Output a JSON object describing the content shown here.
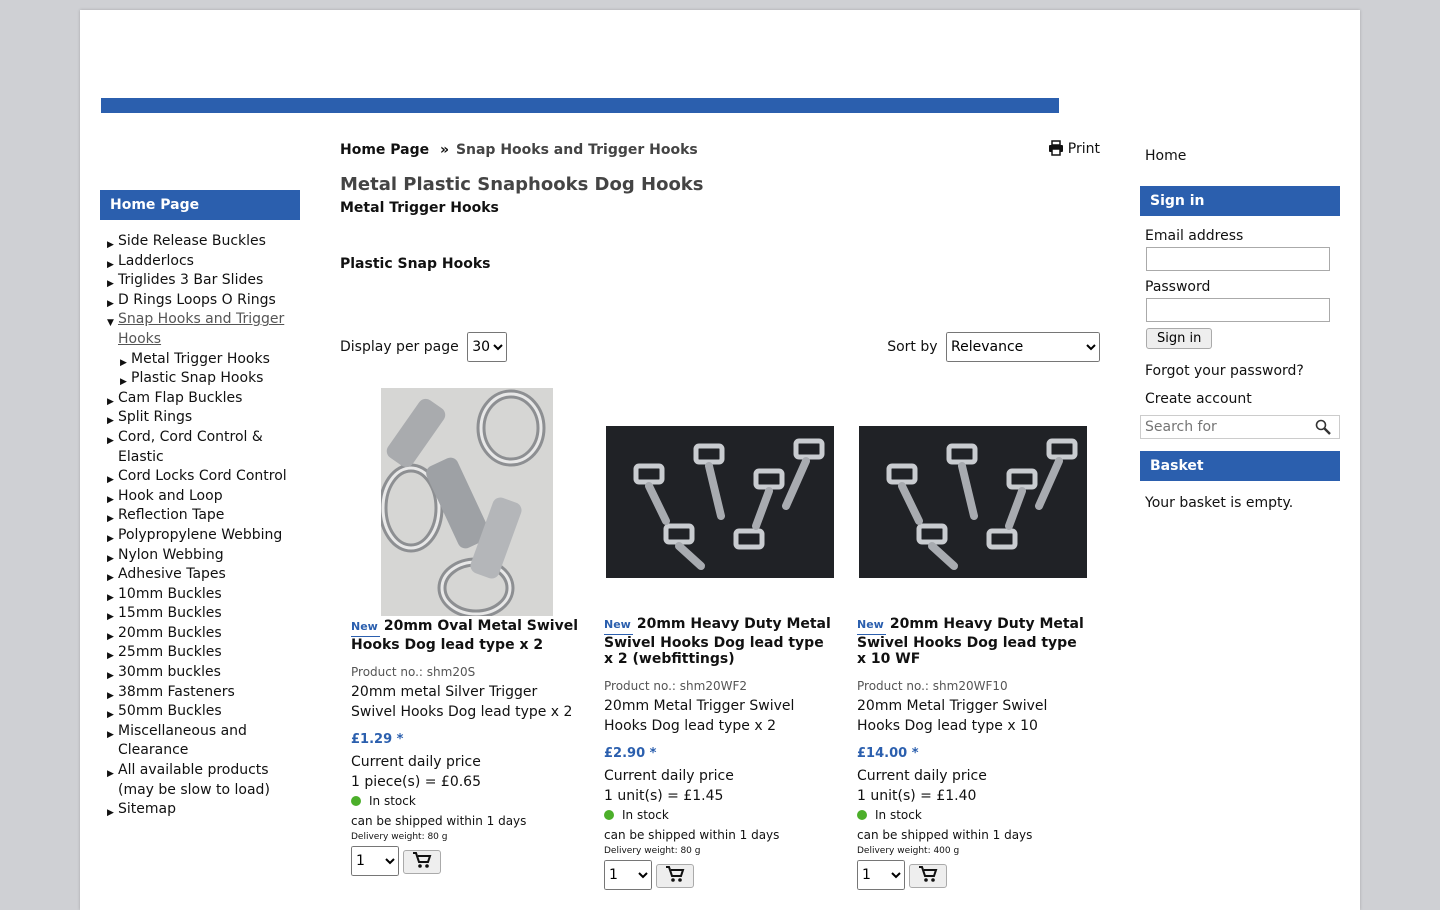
{
  "left_nav": {
    "heading": "Home Page",
    "items": [
      {
        "label": "Side Release Buckles"
      },
      {
        "label": "Ladderlocs"
      },
      {
        "label": "Triglides 3 Bar Slides"
      },
      {
        "label": "D Rings Loops O Rings"
      },
      {
        "label": "Snap Hooks and Trigger Hooks",
        "open": true
      },
      {
        "label": "Metal Trigger Hooks",
        "sub": true
      },
      {
        "label": "Plastic Snap Hooks",
        "sub": true
      },
      {
        "label": "Cam Flap Buckles"
      },
      {
        "label": "Split Rings"
      },
      {
        "label": "Cord, Cord Control & Elastic"
      },
      {
        "label": "Cord Locks Cord Control"
      },
      {
        "label": "Hook and Loop"
      },
      {
        "label": "Reflection Tape"
      },
      {
        "label": "Polypropylene Webbing"
      },
      {
        "label": "Nylon Webbing"
      },
      {
        "label": "Adhesive Tapes"
      },
      {
        "label": "10mm Buckles"
      },
      {
        "label": "15mm Buckles"
      },
      {
        "label": "20mm Buckles"
      },
      {
        "label": "25mm Buckles"
      },
      {
        "label": "30mm buckles"
      },
      {
        "label": "38mm Fasteners"
      },
      {
        "label": "50mm Buckles"
      },
      {
        "label": "Miscellaneous and Clearance"
      },
      {
        "label": "All available products (may be slow to load)"
      },
      {
        "label": "Sitemap"
      }
    ]
  },
  "breadcrumb": {
    "home": "Home Page",
    "separator": "»",
    "current": "Snap Hooks and Trigger Hooks"
  },
  "print_label": "Print",
  "page_title": "Metal Plastic Snaphooks Dog Hooks",
  "subcategories": [
    "Metal Trigger Hooks",
    "Plastic Snap Hooks"
  ],
  "controls": {
    "display_label": "Display per page",
    "display_value": "30",
    "sort_label": "Sort by",
    "sort_value": "Relevance"
  },
  "products": [
    {
      "badge": "New",
      "name": "20mm Oval Metal Swivel Hooks Dog lead type x 2",
      "product_no": "Product no.: shm20S",
      "description": "20mm metal Silver Trigger Swivel Hooks Dog lead type x 2",
      "price": "£1.29 *",
      "daily_label": "Current daily price",
      "unit_price": "1 piece(s) = £0.65",
      "stock": "In stock",
      "shipping": "can be shipped within 1 days",
      "weight": "Delivery weight: 80 g",
      "qty": "1"
    },
    {
      "badge": "New",
      "name": "20mm Heavy Duty Metal Swivel Hooks Dog lead type x 2 (webfittings)",
      "product_no": "Product no.: shm20WF2",
      "description": "20mm Metal Trigger Swivel Hooks Dog lead type x 2",
      "price": "£2.90 *",
      "daily_label": "Current daily price",
      "unit_price": "1 unit(s) = £1.45",
      "stock": "In stock",
      "shipping": "can be shipped within 1 days",
      "weight": "Delivery weight: 80 g",
      "qty": "1"
    },
    {
      "badge": "New",
      "name": "20mm Heavy Duty Metal Swivel Hooks Dog lead type x 10 WF",
      "product_no": "Product no.: shm20WF10",
      "description": "20mm Metal Trigger Swivel Hooks Dog lead type x 10",
      "price": "£14.00 *",
      "daily_label": "Current daily price",
      "unit_price": "1 unit(s) = £1.40",
      "stock": "In stock",
      "shipping": "can be shipped within 1 days",
      "weight": "Delivery weight: 400 g",
      "qty": "1"
    }
  ],
  "right_sidebar": {
    "home_link": "Home",
    "signin_heading": "Sign in",
    "email_label": "Email address",
    "password_label": "Password",
    "signin_button": "Sign in",
    "forgot_link": "Forgot your password?",
    "create_link": "Create account",
    "search_placeholder": "Search for",
    "basket_heading": "Basket",
    "basket_message": "Your basket is empty."
  },
  "colors": {
    "accent": "#2b5fae",
    "in_stock": "#4caf2a"
  }
}
